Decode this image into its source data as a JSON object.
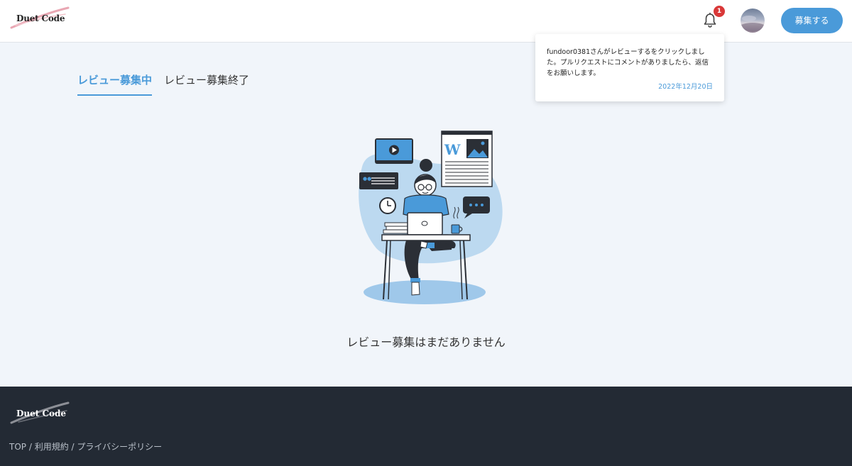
{
  "header": {
    "logo": "Duet Code",
    "notification_count": "1",
    "post_button": "募集する"
  },
  "notification": {
    "message": "fundoor0381さんがレビューするをクリックしました。プルリクエストにコメントがありましたら、返信をお願いします。",
    "date": "2022年12月20日"
  },
  "tabs": {
    "active": "レビュー募集中",
    "inactive": "レビュー募集終了"
  },
  "main": {
    "empty_message": "レビュー募集はまだありません"
  },
  "footer": {
    "logo": "Duet Code",
    "links": [
      {
        "label": "TOP"
      },
      {
        "label": "利用規約"
      },
      {
        "label": "プライバシーポリシー"
      }
    ],
    "separator": " / "
  },
  "colors": {
    "accent": "#4a9ad9",
    "badge": "#d93838",
    "footer_bg": "#232a34",
    "page_bg": "#f1f5fa"
  }
}
